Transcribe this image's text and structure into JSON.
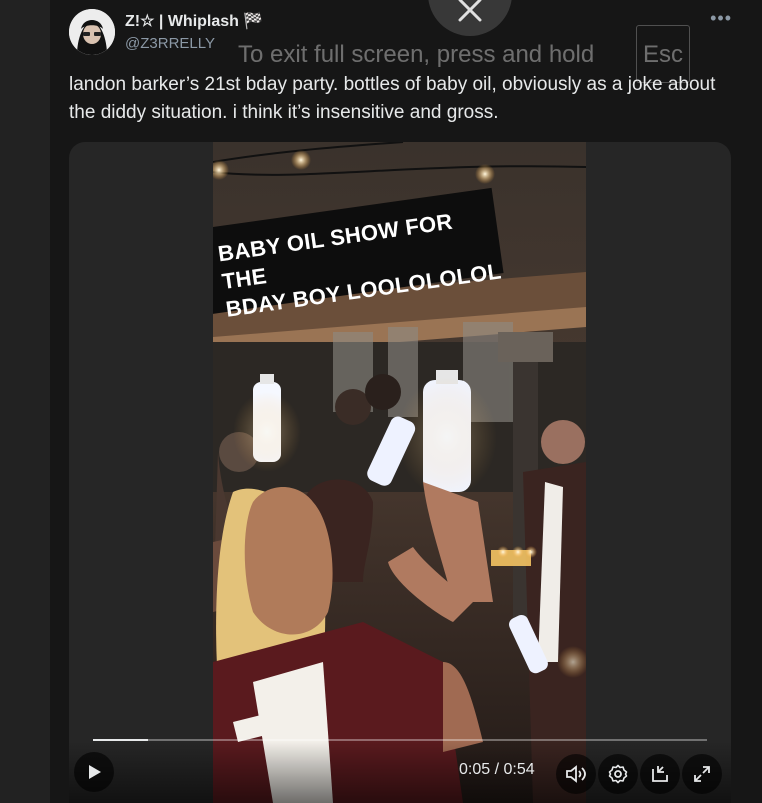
{
  "tweet": {
    "display_name": "Z!☆ | Whiplash 🏁",
    "handle": "@Z3RRELLY",
    "text": "landon barker’s 21st bday party. bottles of baby oil, obviously as a joke about the diddy situation. i think it’s insensitive and gross.",
    "more_icon": "more-horizontal-icon"
  },
  "fullscreen_overlay": {
    "hint": "To exit full screen, press and hold",
    "key": "Esc",
    "close_icon": "close-icon"
  },
  "video": {
    "caption_line1": "BABY OIL SHOW FOR THE",
    "caption_line2": "BDAY BOY LOOLOLOLOL",
    "current_time": "0:05",
    "separator": " / ",
    "duration": "0:54",
    "progress": 0.09,
    "icons": [
      "play-icon",
      "volume-icon",
      "settings-icon",
      "picture-in-picture-icon",
      "fullscreen-icon"
    ]
  },
  "colors": {
    "background": "#161616",
    "text": "#e7e9ea",
    "secondary_text": "#8b98a5"
  }
}
